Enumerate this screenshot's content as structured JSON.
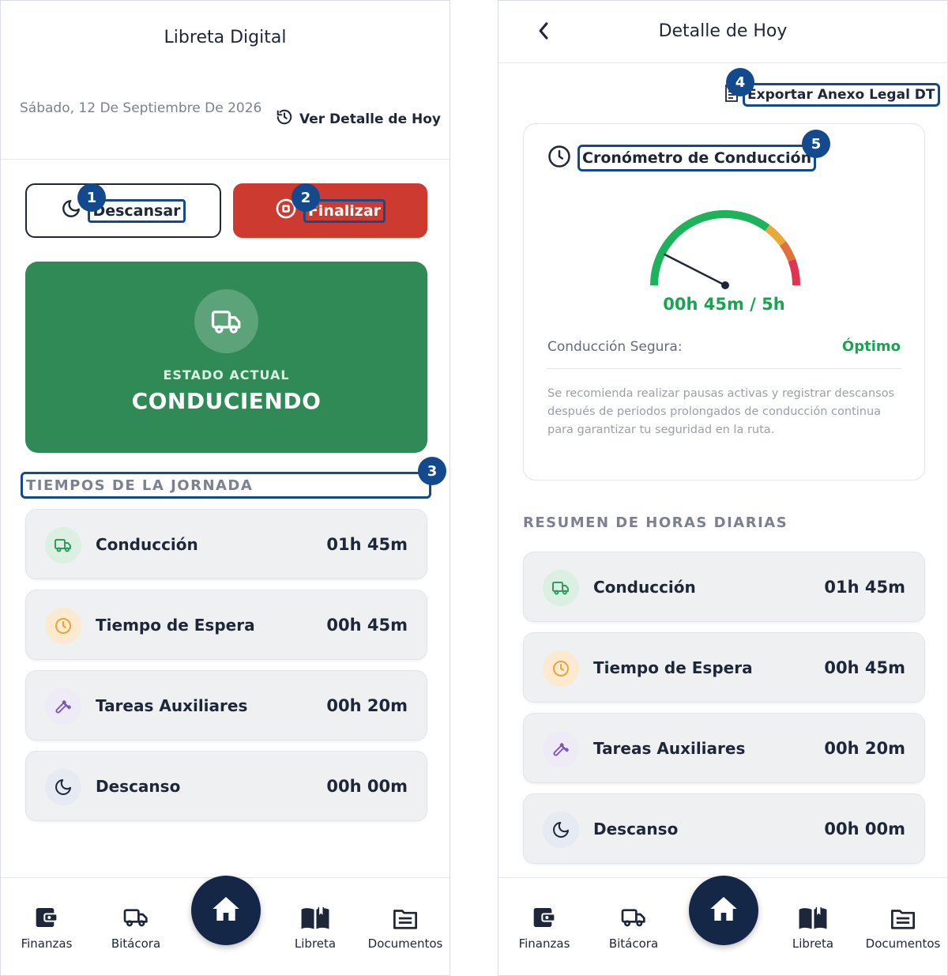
{
  "left": {
    "header": {
      "title": "Libreta Digital"
    },
    "date": "Sábado, 12 De Septiembre De 2026",
    "detail_link": "Ver Detalle de Hoy",
    "actions": {
      "rest_label": "Descansar",
      "finish_label": "Finalizar"
    },
    "status": {
      "caption": "ESTADO ACTUAL",
      "value": "CONDUCIENDO"
    },
    "section_title": "TIEMPOS DE LA JORNADA",
    "rows": [
      {
        "label": "Conducción",
        "value": "01h 45m",
        "icon": "truck-icon"
      },
      {
        "label": "Tiempo de Espera",
        "value": "00h 45m",
        "icon": "clock-icon"
      },
      {
        "label": "Tareas Auxiliares",
        "value": "00h 20m",
        "icon": "wrench-icon"
      },
      {
        "label": "Descanso",
        "value": "00h 00m",
        "icon": "moon-icon"
      }
    ]
  },
  "right": {
    "header": {
      "title": "Detalle de Hoy"
    },
    "export_link": "Exportar Anexo Legal DT",
    "gauge": {
      "title": "Cronómetro de Conducción",
      "reading": "00h 45m / 5h",
      "driven_minutes": 45,
      "limit_minutes": 300,
      "safe_label": "Conducción Segura:",
      "safe_value": "Óptimo",
      "recommendation": "Se recomienda realizar pausas activas y registrar descansos después de periodos prolongados de conducción continua para garantizar tu seguridad en la ruta."
    },
    "section_title": "RESUMEN DE HORAS DIARIAS",
    "rows": [
      {
        "label": "Conducción",
        "value": "01h 45m",
        "icon": "truck-icon"
      },
      {
        "label": "Tiempo de Espera",
        "value": "00h 45m",
        "icon": "clock-icon"
      },
      {
        "label": "Tareas Auxiliares",
        "value": "00h 20m",
        "icon": "wrench-icon"
      },
      {
        "label": "Descanso",
        "value": "00h 00m",
        "icon": "moon-icon"
      }
    ]
  },
  "nav": {
    "items": [
      "Finanzas",
      "Bitácora",
      "Libreta",
      "Documentos"
    ],
    "home_icon": "home-icon"
  },
  "annotations": [
    "1",
    "2",
    "3",
    "4",
    "5"
  ],
  "colors": {
    "primary_navy": "#152746",
    "finish_red": "#cd3b30",
    "status_green": "#2f8a55",
    "ok_green": "#1aa452",
    "annotation_blue": "#134a8e"
  }
}
